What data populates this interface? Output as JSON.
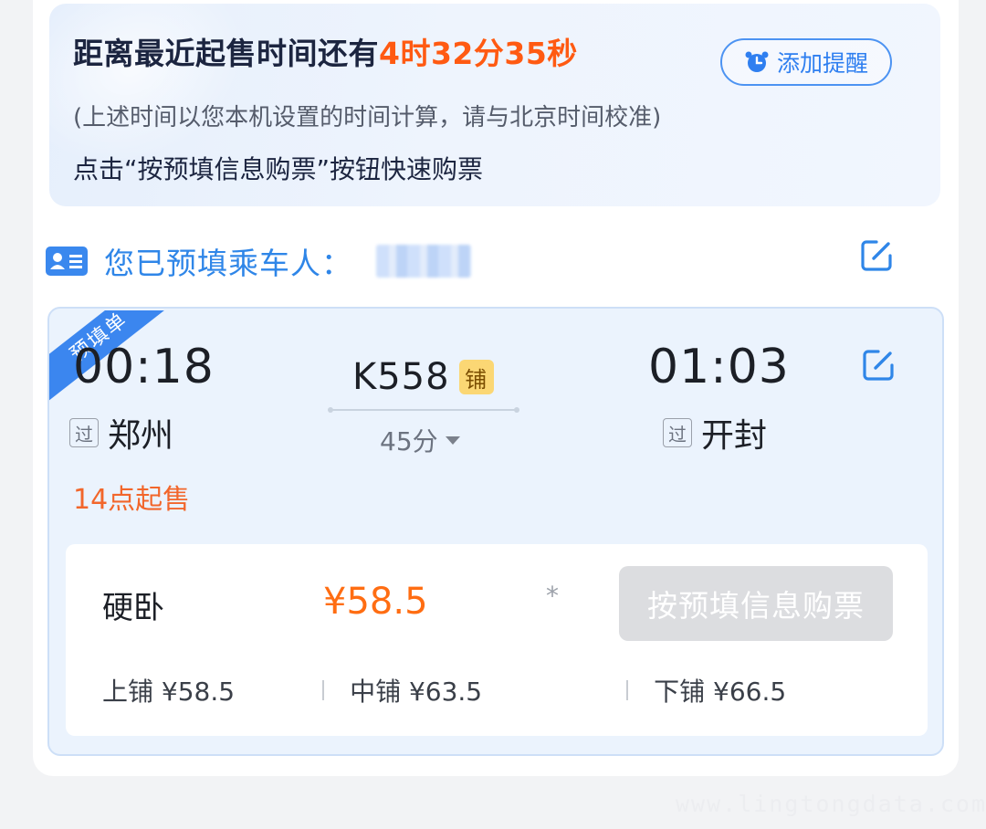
{
  "countdown": {
    "prefix": "距离最近起售时间还有",
    "time": "4时32分35秒",
    "remind_label": "添加提醒",
    "note": "(上述时间以您本机设置的时间计算，请与北京时间校准)",
    "tip": "点击“按预填信息购票”按钮快速购票"
  },
  "passenger": {
    "label": "您已预填乘车人："
  },
  "train": {
    "ribbon": "预填单",
    "depart_time": "00:18",
    "depart_station": "郑州",
    "depart_via": "过",
    "arrive_time": "01:03",
    "arrive_station": "开封",
    "arrive_via": "过",
    "number": "K558",
    "berth_badge": "铺",
    "duration": "45分",
    "sale_time": "14点起售"
  },
  "seat": {
    "name": "硬卧",
    "price": "¥58.5",
    "star": "*",
    "buy_label": "按预填信息购票",
    "berths": [
      {
        "label": "上铺 ¥58.5"
      },
      {
        "label": "中铺 ¥63.5"
      },
      {
        "label": "下铺 ¥66.5"
      }
    ]
  },
  "watermark": "www.lingtongdata.com",
  "colors": {
    "accent": "#2f86e8",
    "countdown": "#ff5a12",
    "price": "#ff6d12",
    "sale": "#f2662b",
    "disabled_button": "#dcdde0"
  }
}
